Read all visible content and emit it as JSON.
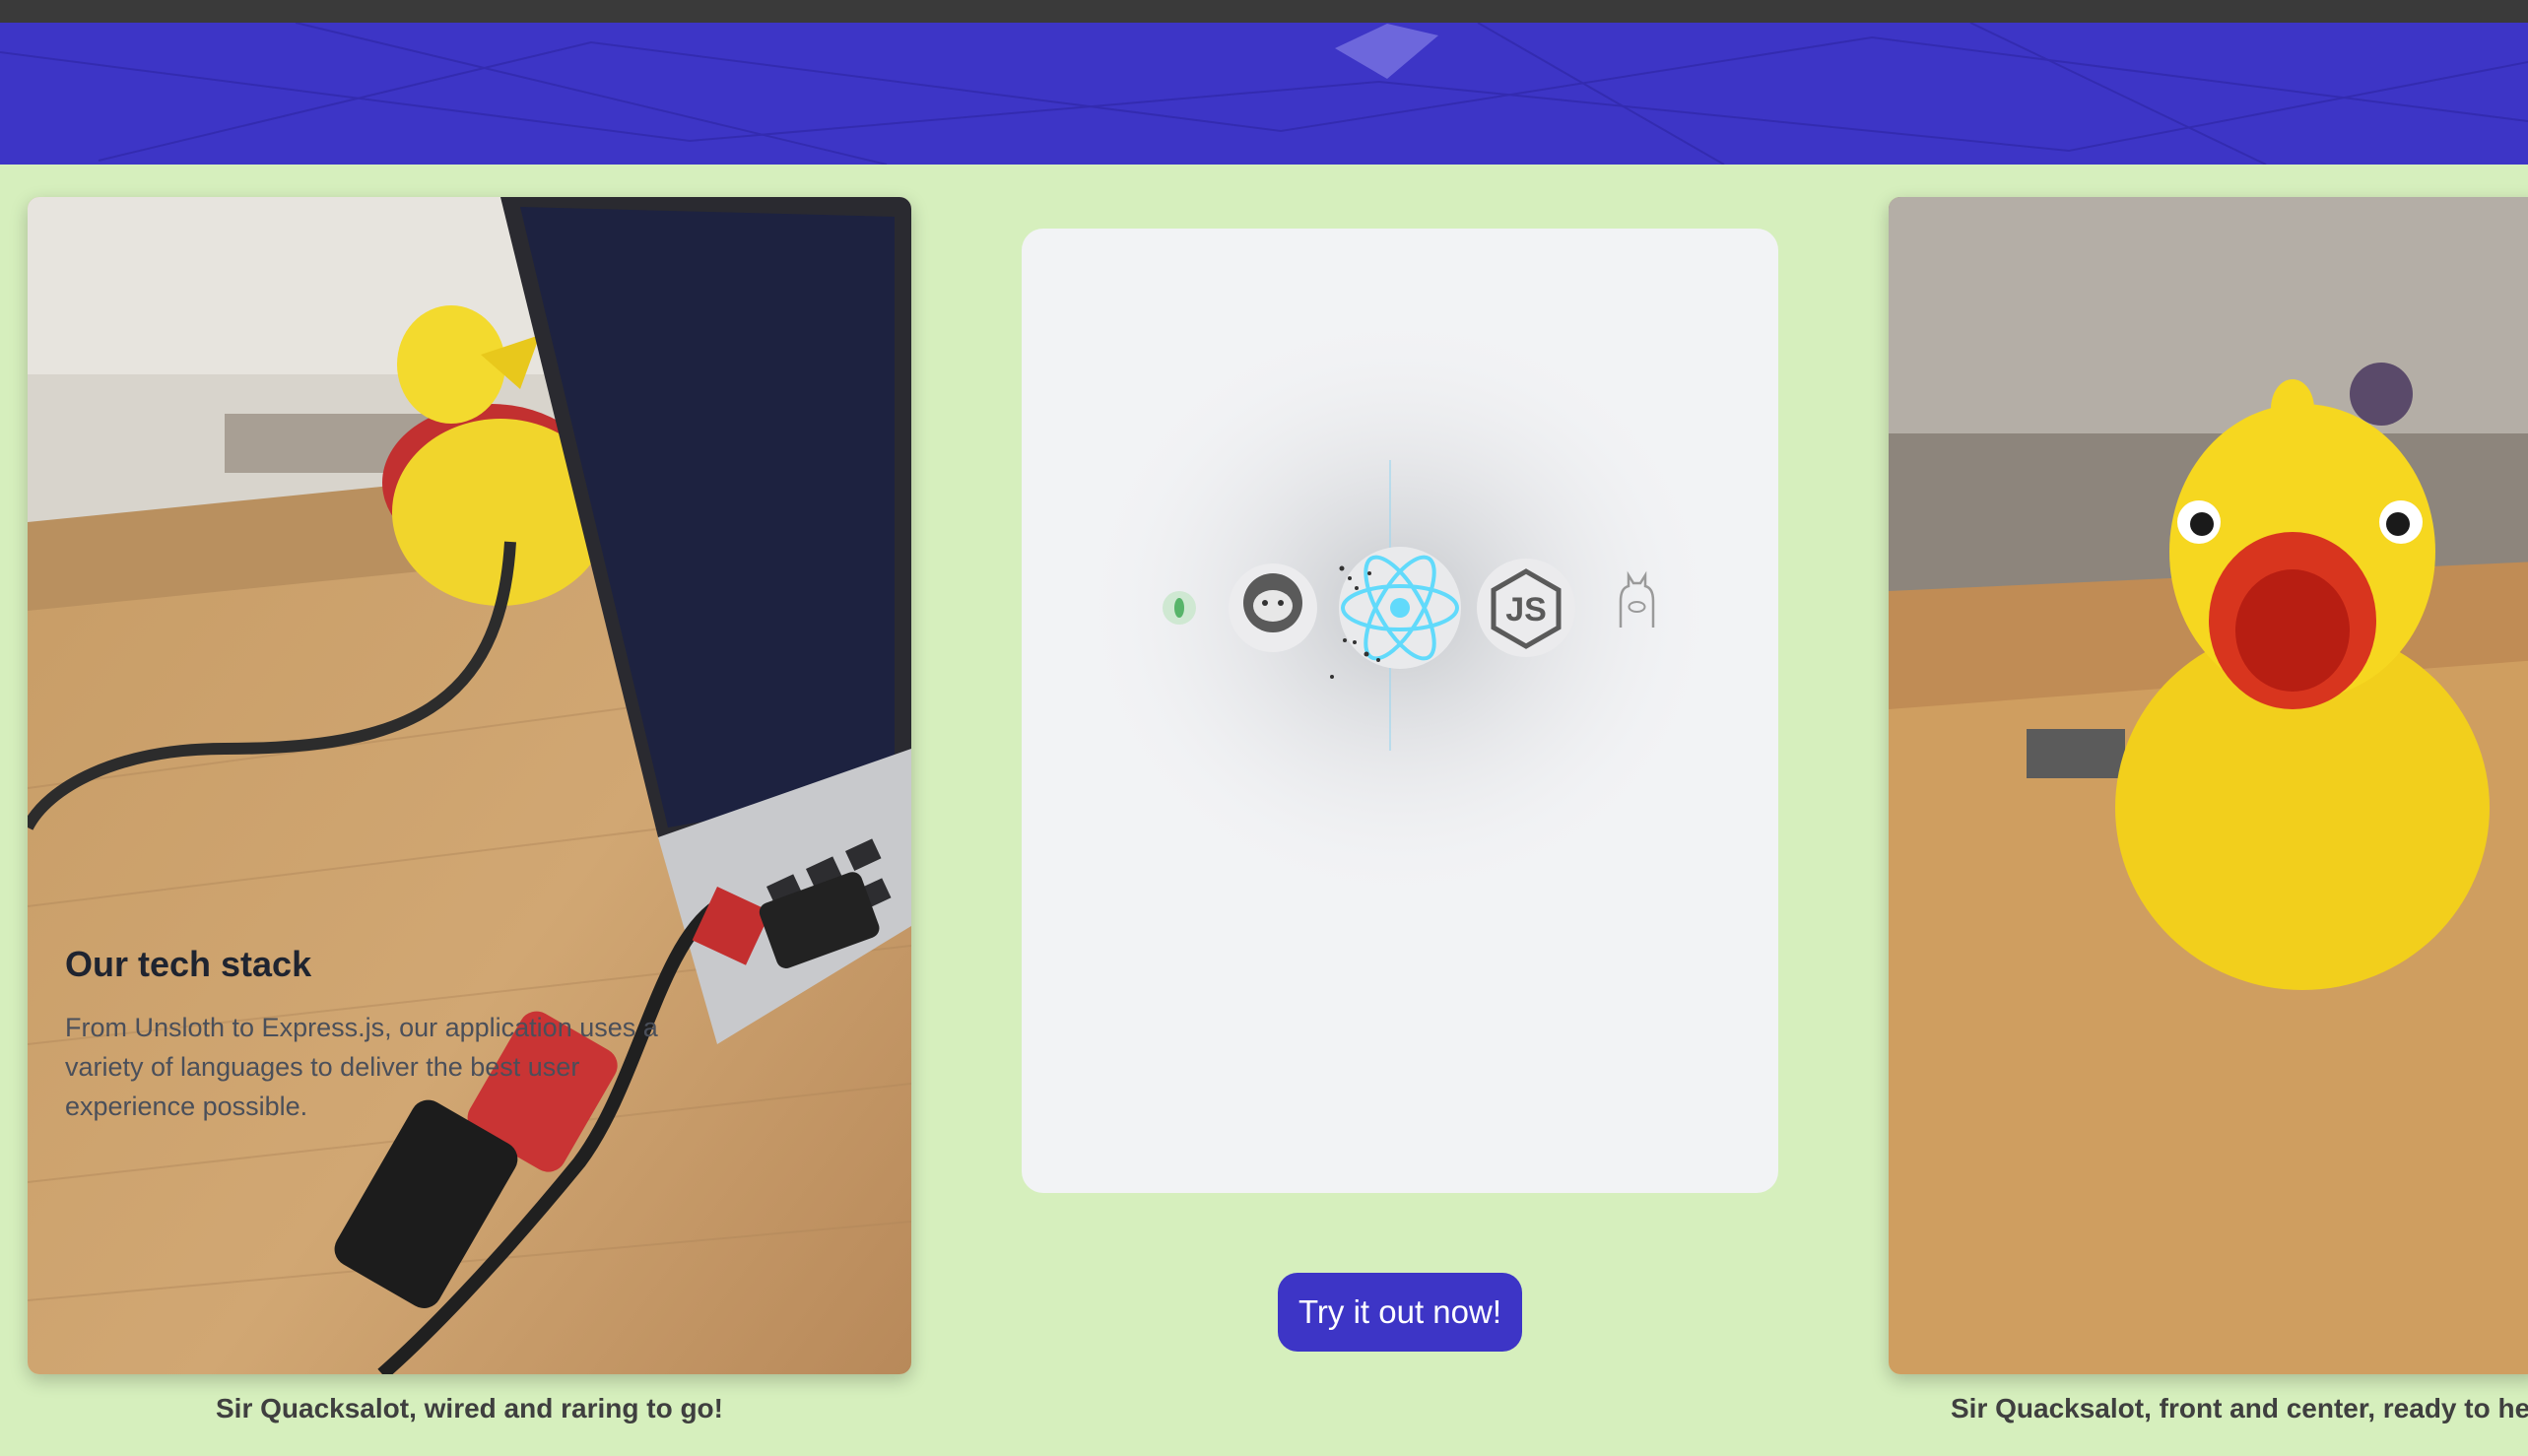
{
  "card": {
    "title": "Our tech stack",
    "description": "From Unsloth to Express.js, our application uses a variety of languages to deliver the best user experience possible."
  },
  "stack_icons": [
    "leaf-icon",
    "sloth-icon",
    "react-icon",
    "nodejs-icon",
    "llama-icon"
  ],
  "cta": {
    "label": "Try it out now!"
  },
  "gallery": {
    "left_caption": "Sir Quacksalot, wired and raring to go!",
    "right_caption": "Sir Quacksalot, front and center, ready to he"
  },
  "colors": {
    "banner": "#3d35c6",
    "page_background": "#d6efbd",
    "card_background": "#f2f3f5",
    "button": "#3d35c6",
    "react_blue": "#61dafb"
  }
}
